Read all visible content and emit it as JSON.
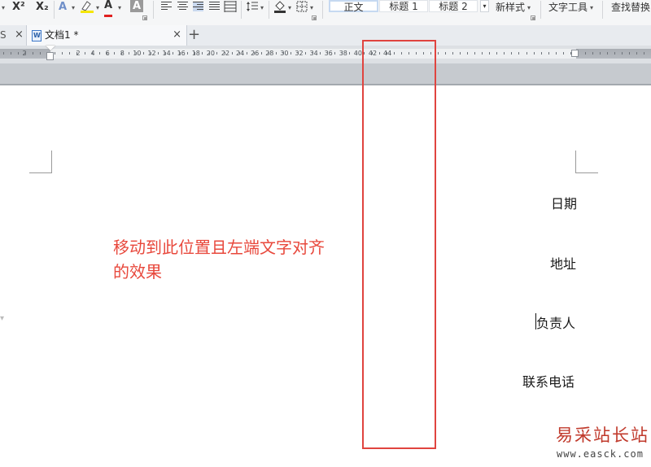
{
  "toolbar": {
    "superscript_label": "X²",
    "subscript_label": "X₂",
    "font_color_letter": "A",
    "char_shade_letter": "A",
    "styles": [
      "正文",
      "标题 1",
      "标题 2"
    ],
    "new_style_label": "新样式",
    "text_tools_label": "文字工具",
    "find_replace_label": "查找替换"
  },
  "tabs": {
    "prev_tab_fragment": "S",
    "active_title": "文档1 *",
    "close_glyph": "×",
    "new_tab_glyph": "+"
  },
  "ruler": {
    "labels": [
      "2",
      "2",
      "4",
      "6",
      "8",
      "10",
      "12",
      "14",
      "16",
      "18",
      "20",
      "22",
      "24",
      "26",
      "28",
      "30",
      "32",
      "34",
      "36",
      "38",
      "40",
      "42",
      "44"
    ]
  },
  "document": {
    "fields": [
      "日期",
      "地址",
      "负责人",
      "联系电话"
    ],
    "annotation_line1": "移动到此位置且左端文字对齐",
    "annotation_line2": "的效果"
  },
  "watermark": {
    "site_name": "易采站长站",
    "url": "www.easck.com"
  },
  "colors": {
    "highlight": "#e0443f",
    "annotation_text": "#e8483c",
    "accent_blue": "#3d78c8"
  }
}
